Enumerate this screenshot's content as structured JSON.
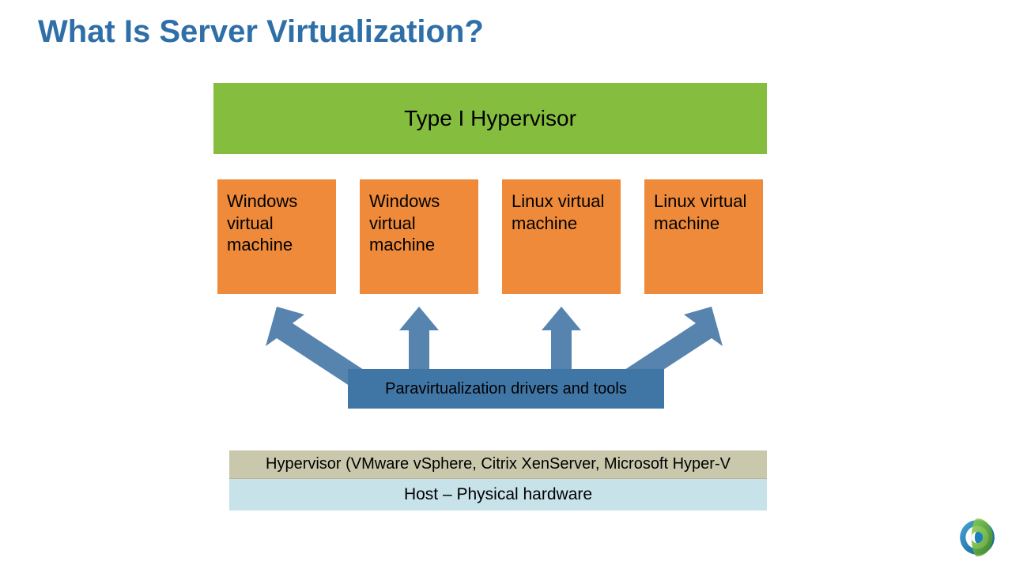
{
  "title": "What Is Server Virtualization?",
  "hypervisor_type": "Type I Hypervisor",
  "vms": [
    "Windows virtual machine",
    "Windows virtual machine",
    "Linux virtual machine",
    "Linux virtual machine"
  ],
  "paravirt": "Paravirtualization drivers and tools",
  "hypervisor_bar": "Hypervisor (VMware vSphere, Citrix XenServer, Microsoft Hyper-V",
  "host_bar": "Host – Physical hardware",
  "colors": {
    "title": "#2f6fa8",
    "type_box": "#85be3f",
    "vm_box": "#ee8a3a",
    "paravirt_box": "#3f76a6",
    "arrow": "#5783af",
    "hypervisor_bar": "#cac8ac",
    "host_bar": "#c8e2ea"
  }
}
